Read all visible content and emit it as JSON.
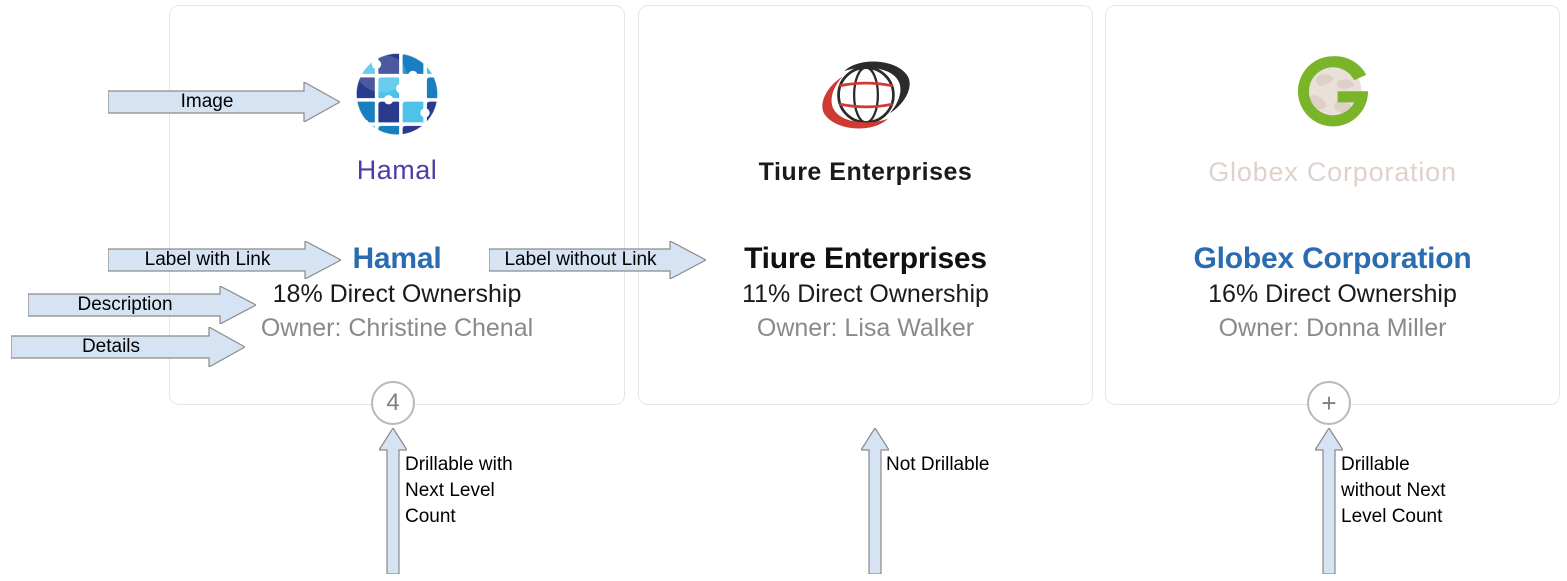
{
  "cards": [
    {
      "logo_alt": "Hamal",
      "logo_wordmark": "Hamal",
      "title": "Hamal",
      "title_is_link": true,
      "description": "18% Direct Ownership",
      "details": "Owner: Christine Chenal",
      "drill_badge": "4",
      "drillable": true
    },
    {
      "logo_alt": "Tiure Enterprises",
      "logo_wordmark": "Tiure Enterprises",
      "title": "Tiure Enterprises",
      "title_is_link": false,
      "description": "11% Direct Ownership",
      "details": "Owner: Lisa Walker",
      "drill_badge": "",
      "drillable": false
    },
    {
      "logo_alt": "Globex Corporation",
      "logo_wordmark": "Globex Corporation",
      "title": "Globex Corporation",
      "title_is_link": true,
      "description": "16% Direct Ownership",
      "details": "Owner: Donna Miller",
      "drill_badge": "+",
      "drillable": true
    }
  ],
  "annotations": {
    "image": "Image",
    "label_with_link": "Label with Link",
    "label_without_link": "Label without Link",
    "description": "Description",
    "details": "Details",
    "drillable_with_count": "Drillable with\nNext Level\nCount",
    "not_drillable": "Not Drillable",
    "drillable_without_count": "Drillable\nwithout Next\nLevel Count"
  },
  "colors": {
    "link": "#2b6cb0",
    "card_border": "#e6e6e6",
    "callout_fill": "#d6e3f2",
    "callout_stroke": "#8a8a8a",
    "details_text": "#8a8a8a",
    "badge_stroke": "#b9b9b9",
    "hamal_navy": "#2a3a8f",
    "hamal_blue": "#1a7fc1",
    "hamal_cyan": "#4ec3ea",
    "tiure_red": "#cf3a35",
    "tiure_black": "#2b2b2b",
    "globex_green": "#7ab529",
    "globex_text": "#ded2cb"
  }
}
